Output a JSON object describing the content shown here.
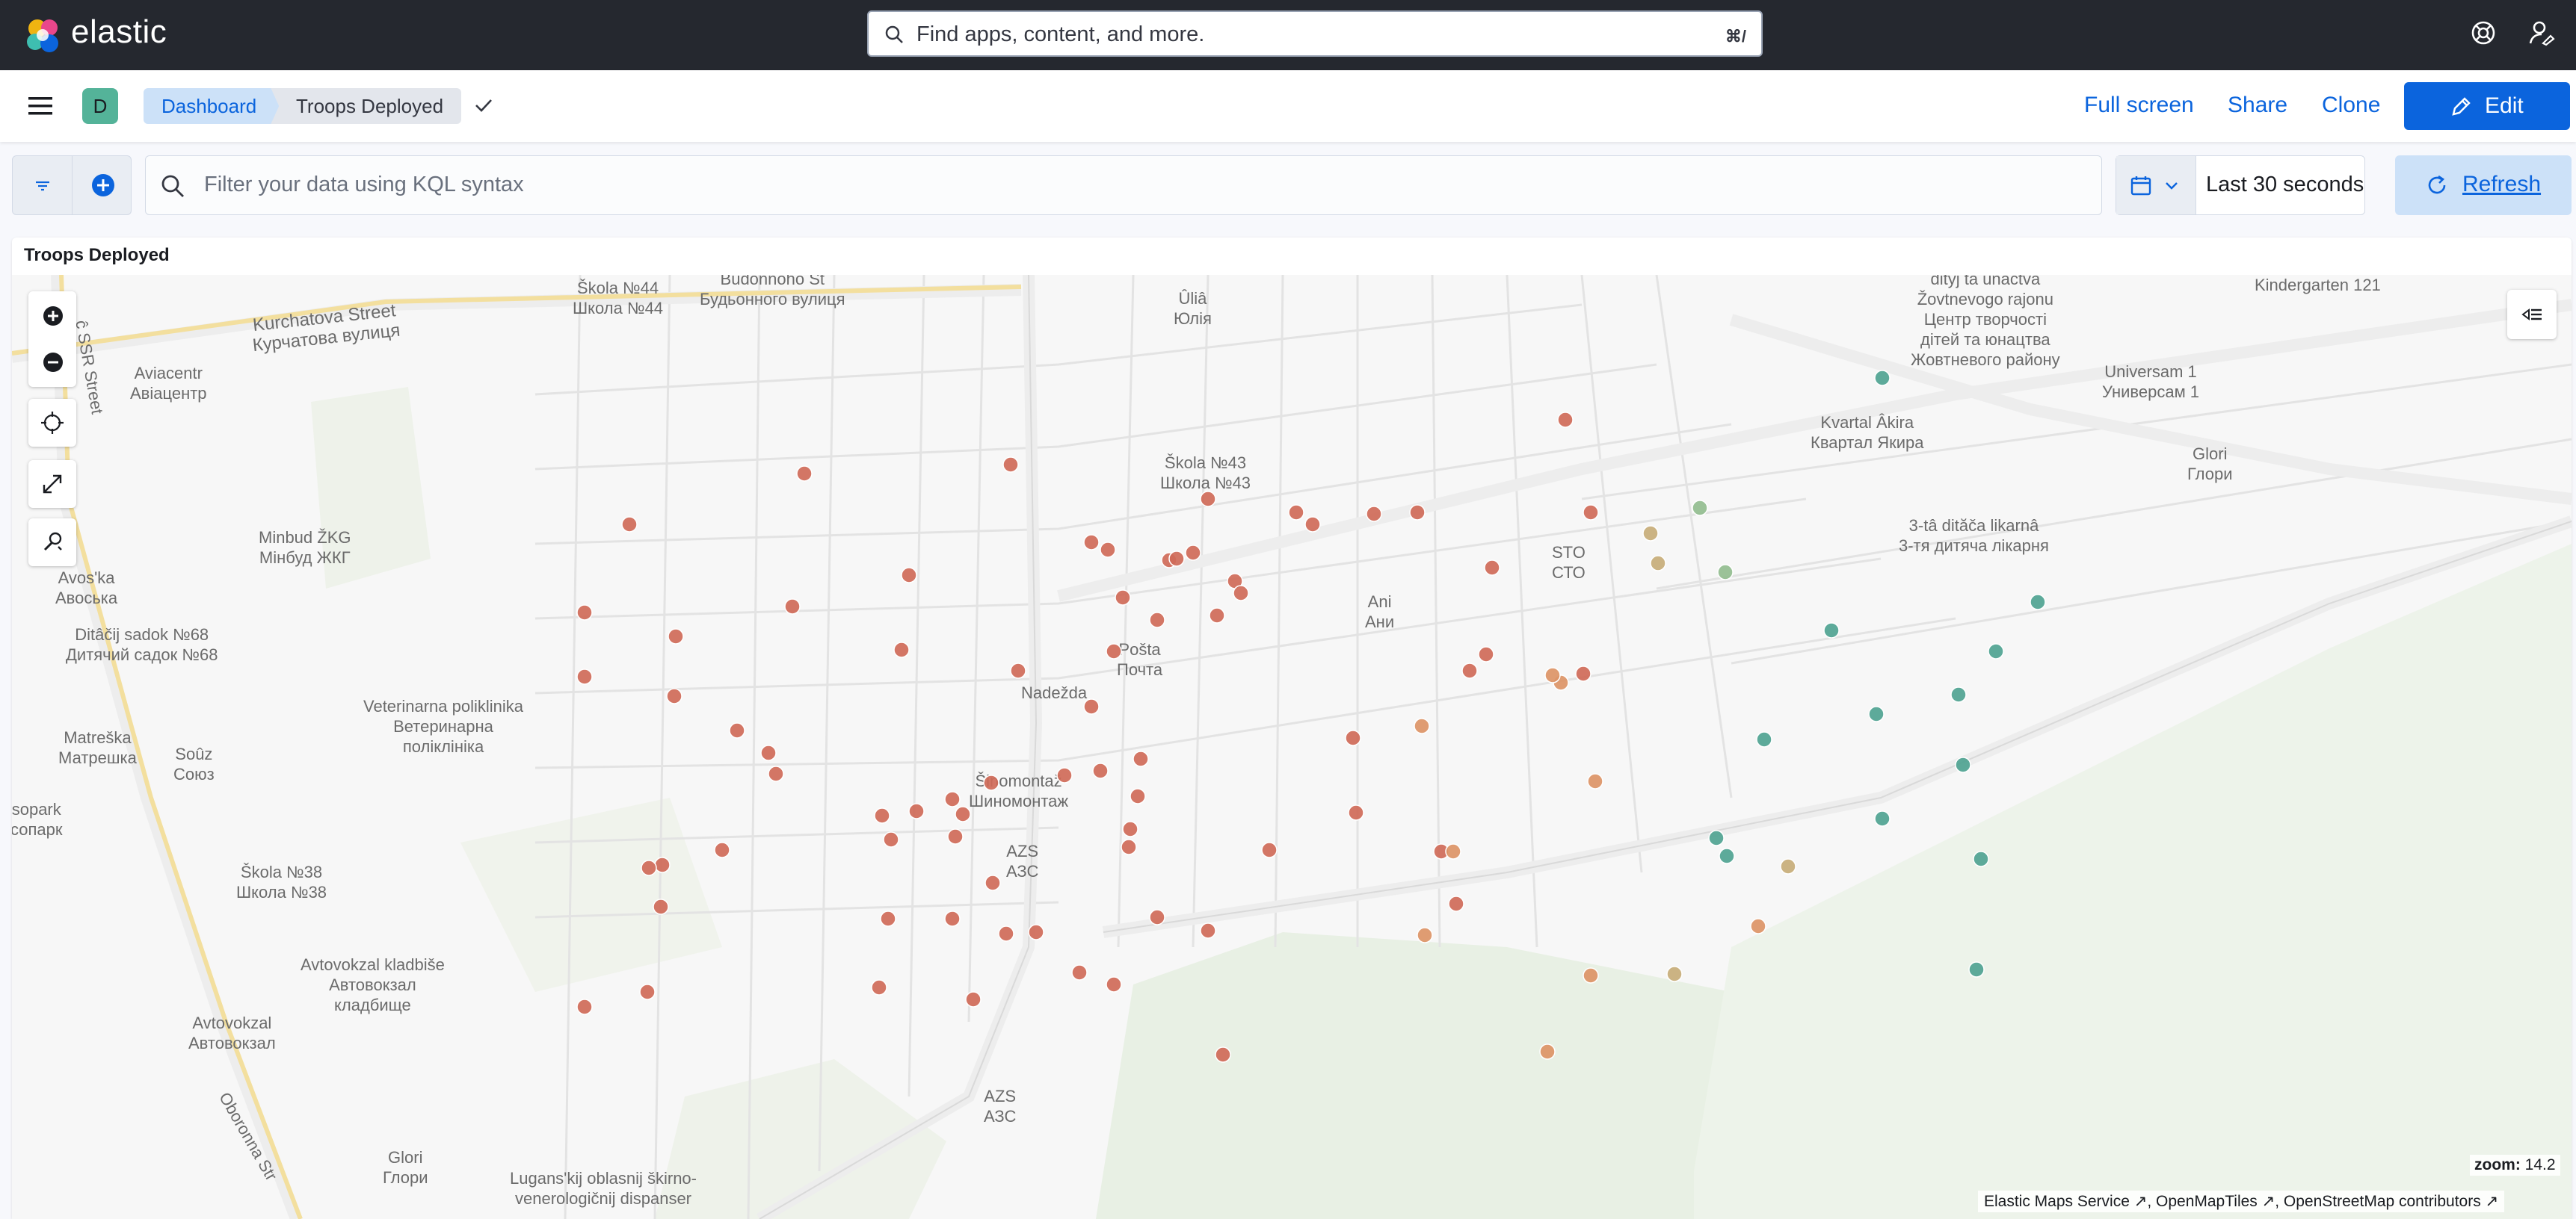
{
  "header": {
    "brand": "elastic",
    "search_placeholder": "Find apps, content, and more.",
    "search_shortcut": "⌘/"
  },
  "breadcrumbs": {
    "avatar_letter": "D",
    "items": [
      "Dashboard",
      "Troops Deployed"
    ]
  },
  "actions": {
    "full_screen": "Full screen",
    "share": "Share",
    "clone": "Clone",
    "edit": "Edit"
  },
  "query": {
    "placeholder": "Filter your data using KQL syntax",
    "time_range": "Last 30 seconds",
    "refresh": "Refresh"
  },
  "panel": {
    "title": "Troops Deployed",
    "zoom_label": "zoom:",
    "zoom_value": "14.2",
    "attribution": [
      "Elastic Maps Service",
      "OpenMapTiles",
      "OpenStreetMap contributors"
    ]
  },
  "map_labels": [
    "Škola №44\nШкола №44",
    "Budonnoho St\nБудьонного вулиця",
    "Kurchatova Street\nКурчатова вулиця",
    "Aviacentr\nАвіацентр",
    "Ûliâ\nЮлія",
    "dityj ta ûnactva\nŽovtnevogo rajonu\nЦентр творчості\nдітей та юнацтва\nЖовтневого району",
    "Kindergarten 121",
    "Universam 1\nУниверсам 1",
    "Kvartal Âkira\nКвартал Якира",
    "Glori\nГлори",
    "Škola №43\nШкола №43",
    "Minbud ŽKG\nМінбуд ЖКГ",
    "3-tâ dităča likarnâ\n3-тя дитяча лікарня",
    "STO\nСТО",
    "Avos'ka\nАвоська",
    "Ani\nАни",
    "Ditâčij sadok №68\nДитячий садок №68",
    "Pošta\nПочта",
    "Nadežda",
    "Veterinarna poliklinika\nВетеринарна\nполіклініка",
    "Matreška\nМатрешка",
    "Soûz\nСоюз",
    "Šinomontaž\nШиномонтаж",
    "sopark\nсопарк",
    "AZS\nАЗС",
    "Škola №38\nШкола №38",
    "Avtovokzal kladbiše\nАвтовокзал\nкладбище",
    "Avtovokzal\nАвтовокзал",
    "AZS\nАЗС",
    "Glori\nГлори",
    "Lugans'kij oblasnij škirno-\nvenerologičnij dispanser",
    "Oboronna Str",
    "ĉ SSR Street"
  ],
  "colors": {
    "red": "#cf6a58",
    "orange": "#dc9466",
    "tan": "#c7ad78",
    "sage": "#93bd8f",
    "teal": "#4fa391",
    "brand_blue": "#0b64dd"
  },
  "icons": {
    "logo": "elastic-logo-icon",
    "help": "help-icon",
    "user": "user-menu-icon",
    "menu": "hamburger-menu-icon",
    "calendar": "calendar-icon",
    "refresh": "refresh-icon",
    "layers": "layers-panel-icon"
  }
}
